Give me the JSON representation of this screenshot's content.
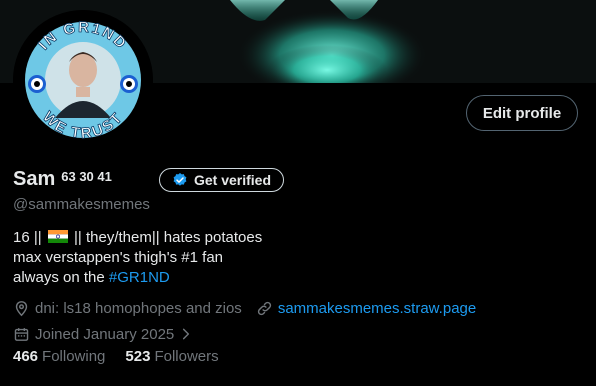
{
  "profile": {
    "name": "Sam",
    "name_superscript": "63 30 41",
    "handle": "@sammakesmemes",
    "avatar_ring_top": "IN GR1ND",
    "avatar_ring_bottom": "WE TRUST",
    "bio_line1_pre": "16 ||",
    "bio_line1_post": "|| they/them|| hates potatoes",
    "bio_line2": "max verstappen's thigh's #1 fan",
    "bio_line3_pre": "always on the",
    "bio_hashtag": "#GR1ND",
    "location": "dni: ls18 homophopes and zios",
    "website": "sammakesmemes.straw.page",
    "joined": "Joined January 2025",
    "following_count": "466",
    "following_label": "Following",
    "followers_count": "523",
    "followers_label": "Followers"
  },
  "buttons": {
    "edit_profile": "Edit profile",
    "get_verified": "Get verified"
  },
  "icons": {
    "location": "location-pin-icon",
    "link": "link-icon",
    "calendar": "calendar-icon",
    "verified": "verified-badge-icon",
    "chevron": "chevron-right-icon"
  },
  "colors": {
    "accent": "#1d9bf0",
    "muted": "#71767b",
    "text": "#e7e9ea",
    "background": "#000000",
    "banner_glow": "#39e6c8"
  }
}
